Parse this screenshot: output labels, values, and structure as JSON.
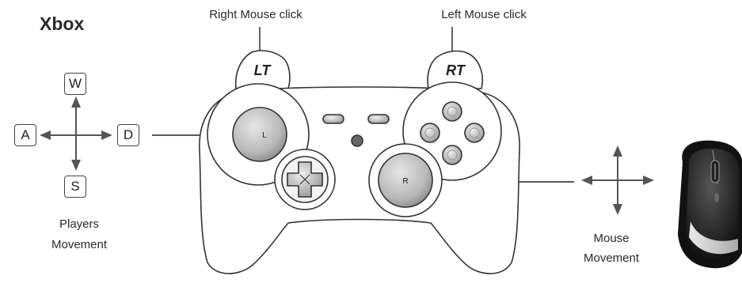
{
  "title": "Xbox",
  "labels": {
    "right_mouse_click": "Right Mouse click",
    "left_mouse_click": "Left Mouse click",
    "players_movement_line1": "Players",
    "players_movement_line2": "Movement",
    "mouse_movement_line1": "Mouse",
    "mouse_movement_line2": "Movement"
  },
  "keys": {
    "up": "W",
    "left": "A",
    "right": "D",
    "down": "S"
  },
  "controller": {
    "left_trigger": "LT",
    "right_trigger": "RT",
    "left_stick": "L",
    "right_stick": "R"
  },
  "icons": [
    "xbox-controller-icon",
    "computer-mouse-icon",
    "four-way-arrow-icon"
  ]
}
